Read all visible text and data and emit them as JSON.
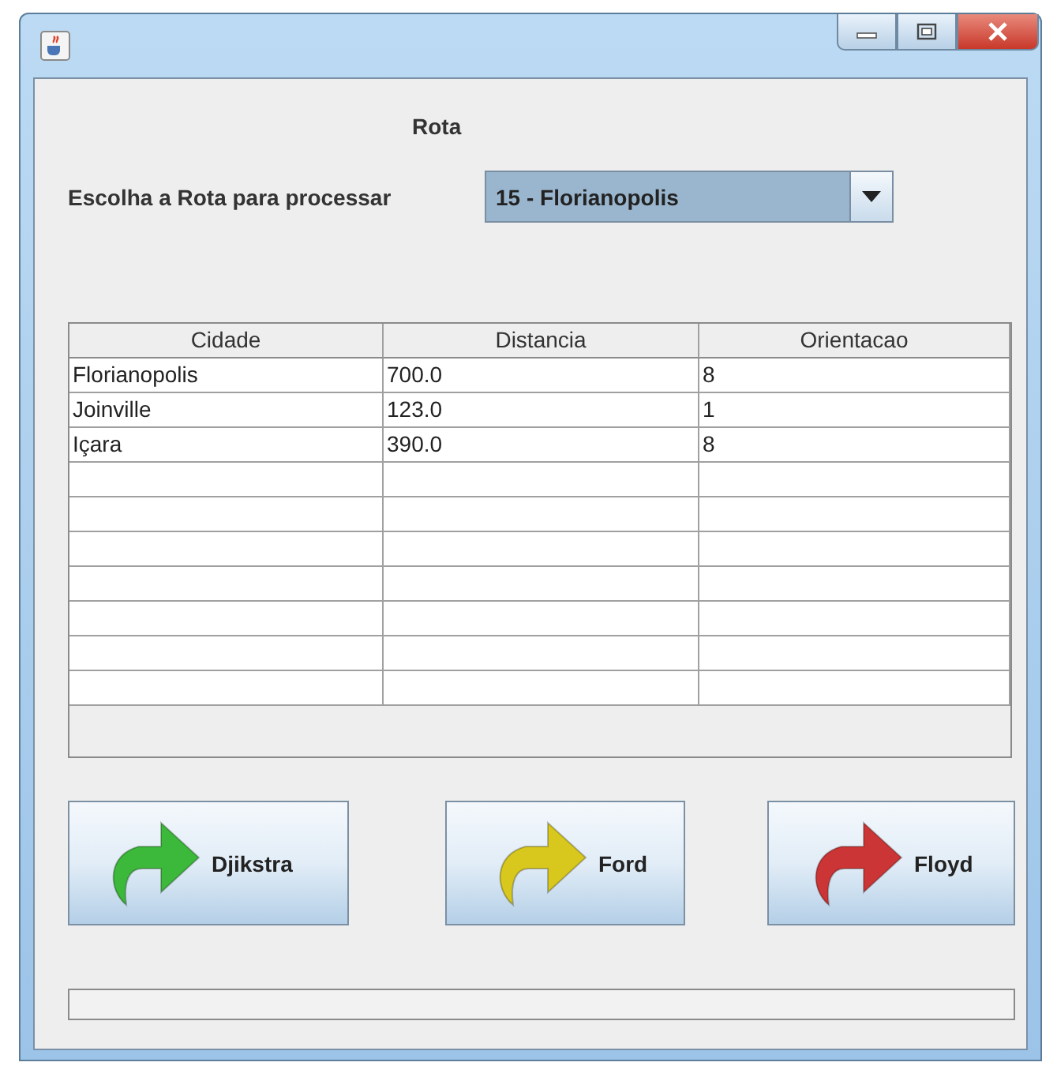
{
  "window": {
    "title_buttons": [
      {
        "kind": "minimize"
      },
      {
        "kind": "maximize"
      },
      {
        "kind": "close"
      }
    ]
  },
  "heading": "Rota",
  "route_label": "Escolha a Rota para processar",
  "route_combo": {
    "value": "15 - Florianopolis"
  },
  "table": {
    "columns": [
      "Cidade",
      "Distancia",
      "Orientacao"
    ],
    "rows": [
      [
        "Florianopolis",
        "700.0",
        "8"
      ],
      [
        "Joinville",
        "123.0",
        "1"
      ],
      [
        "Içara",
        "390.0",
        "8"
      ]
    ]
  },
  "buttons": [
    {
      "label": "Djikstra",
      "color": "#3cb83a"
    },
    {
      "label": "Ford",
      "color": "#d8c81e"
    },
    {
      "label": "Floyd",
      "color": "#cc3535"
    }
  ]
}
